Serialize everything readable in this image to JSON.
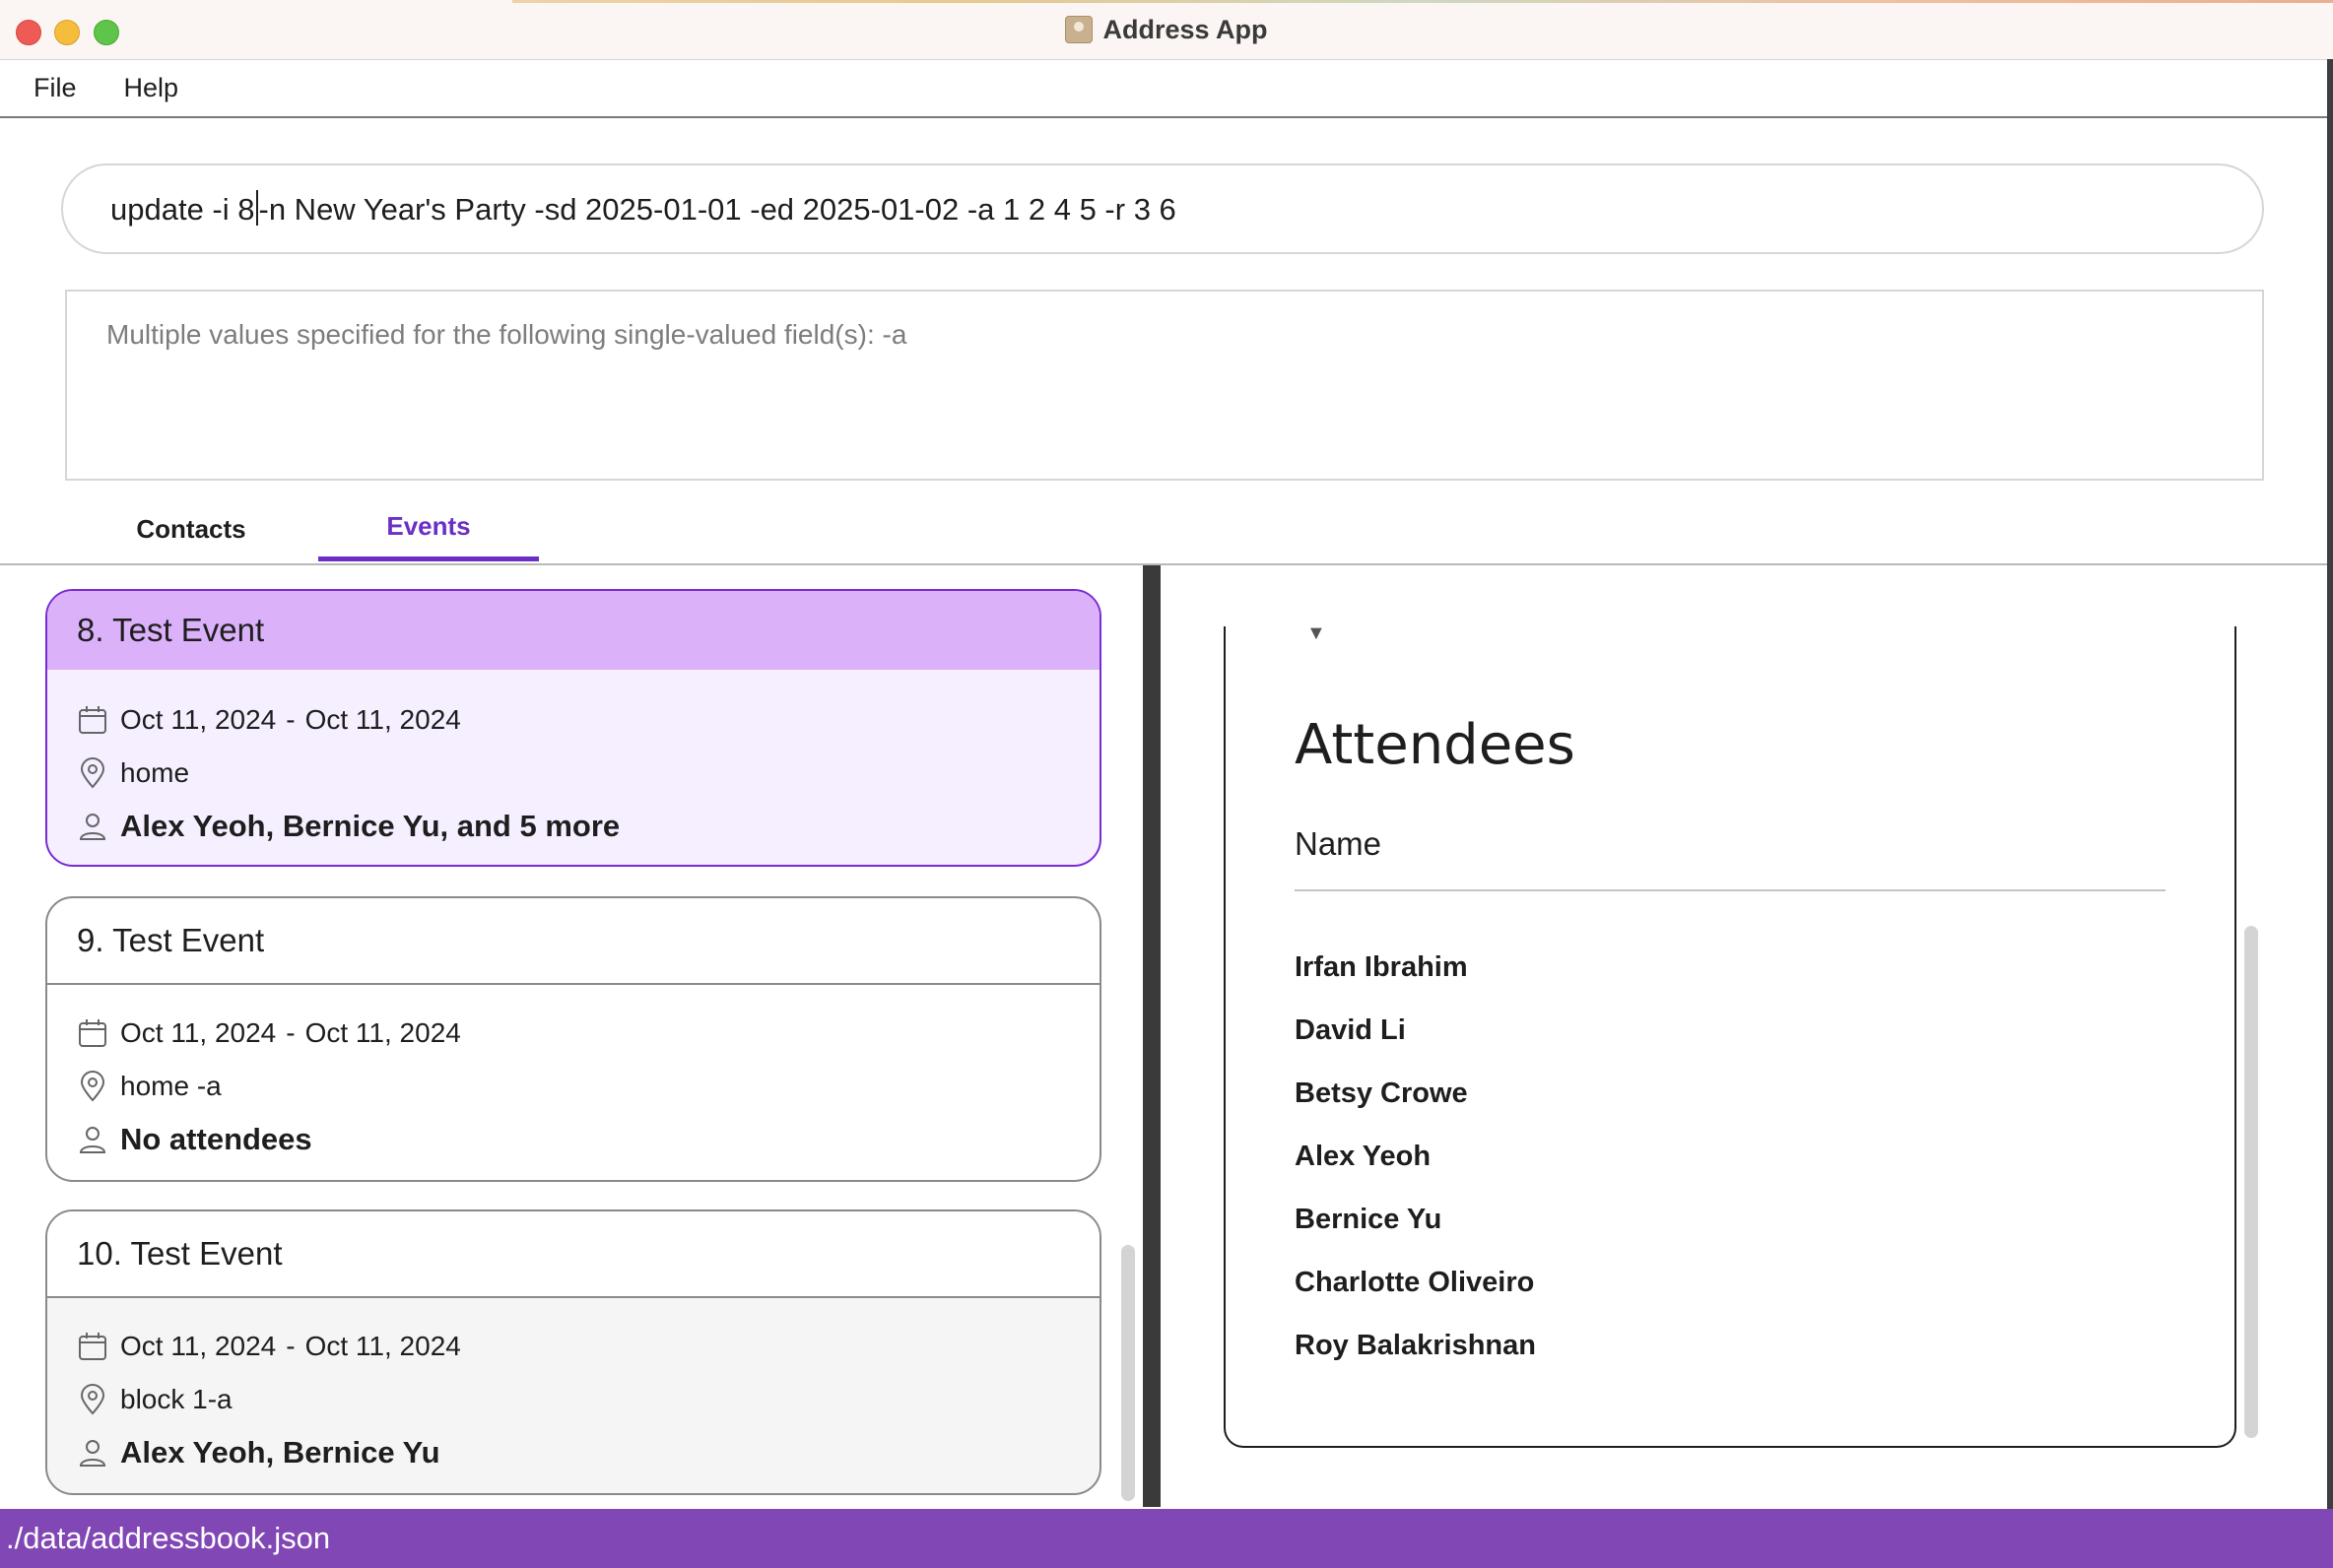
{
  "window": {
    "title": "Address App"
  },
  "menu": {
    "file": "File",
    "help": "Help"
  },
  "command": {
    "before_caret": "update -i 8",
    "after_caret": "-n New Year's Party -sd 2025-01-01 -ed 2025-01-02 -a 1 2 4 5 -r 3 6"
  },
  "result": {
    "message": "Multiple values specified for the following single-valued field(s): -a"
  },
  "tabs": [
    {
      "label": "Contacts"
    },
    {
      "label": "Events"
    }
  ],
  "events": [
    {
      "title": "8. Test Event",
      "date_start": "Oct 11, 2024",
      "date_sep": "-",
      "date_end": "Oct 11, 2024",
      "location": "home",
      "attendees": "Alex Yeoh, Bernice Yu, and 5 more"
    },
    {
      "title": "9. Test Event",
      "date_start": "Oct 11, 2024",
      "date_sep": "-",
      "date_end": "Oct 11, 2024",
      "location": "home -a",
      "attendees": "No attendees"
    },
    {
      "title": "10. Test Event",
      "date_start": "Oct 11, 2024",
      "date_sep": "-",
      "date_end": "Oct 11, 2024",
      "location": "block 1-a",
      "attendees": "Alex Yeoh, Bernice Yu"
    }
  ],
  "detail": {
    "heading": "Attendees",
    "column": "Name",
    "attendees": [
      "Irfan Ibrahim",
      "David Li",
      "Betsy Crowe",
      "Alex Yeoh",
      "Bernice Yu",
      "Charlotte Oliveiro",
      "Roy Balakrishnan"
    ]
  },
  "status": {
    "path": "./data/addressbook.json"
  },
  "colors": {
    "accent": "#6b2fc7",
    "selected_header": "#dbb1fa",
    "status_bar": "#8147b5"
  }
}
